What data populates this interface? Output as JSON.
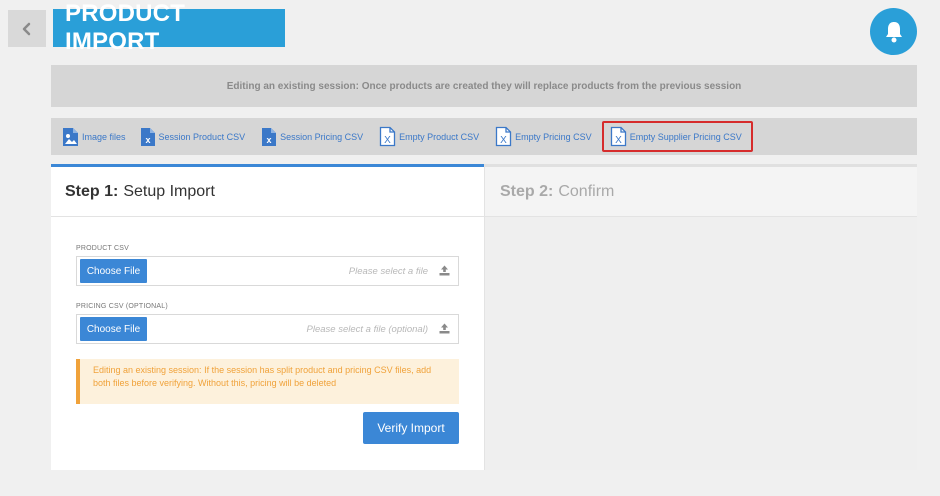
{
  "header": {
    "title": "PRODUCT IMPORT",
    "back_icon": "chevron-left-icon",
    "bell_icon": "bell-icon"
  },
  "banner": {
    "text": "Editing an existing session: Once products are created they will replace products from the previous session"
  },
  "downloads": [
    {
      "label": "Image files",
      "icon": "image-file-icon"
    },
    {
      "label": "Session Product CSV",
      "icon": "excel-file-icon"
    },
    {
      "label": "Session Pricing CSV",
      "icon": "excel-file-icon"
    },
    {
      "label": "Empty Product CSV",
      "icon": "excel-outline-icon"
    },
    {
      "label": "Empty Pricing CSV",
      "icon": "excel-outline-icon"
    },
    {
      "label": "Empty Supplier Pricing CSV",
      "icon": "excel-outline-icon",
      "highlighted": true
    }
  ],
  "steps": {
    "step1": {
      "number": "Step 1:",
      "label": "Setup Import"
    },
    "step2": {
      "number": "Step 2:",
      "label": "Confirm"
    }
  },
  "form": {
    "product_csv": {
      "label": "PRODUCT CSV",
      "button": "Choose File",
      "placeholder": "Please select a file"
    },
    "pricing_csv": {
      "label": "PRICING CSV (OPTIONAL)",
      "button": "Choose File",
      "placeholder": "Please select a file (optional)"
    },
    "warning": "Editing an existing session: If the session has split product and pricing CSV files, add both files before verifying. Without this, pricing will be deleted",
    "verify_button": "Verify Import"
  },
  "colors": {
    "accent": "#2a9fd8",
    "button": "#3b87d6",
    "link": "#3b78c8",
    "highlight": "#d62c2c",
    "warning": "#f0a23a"
  }
}
